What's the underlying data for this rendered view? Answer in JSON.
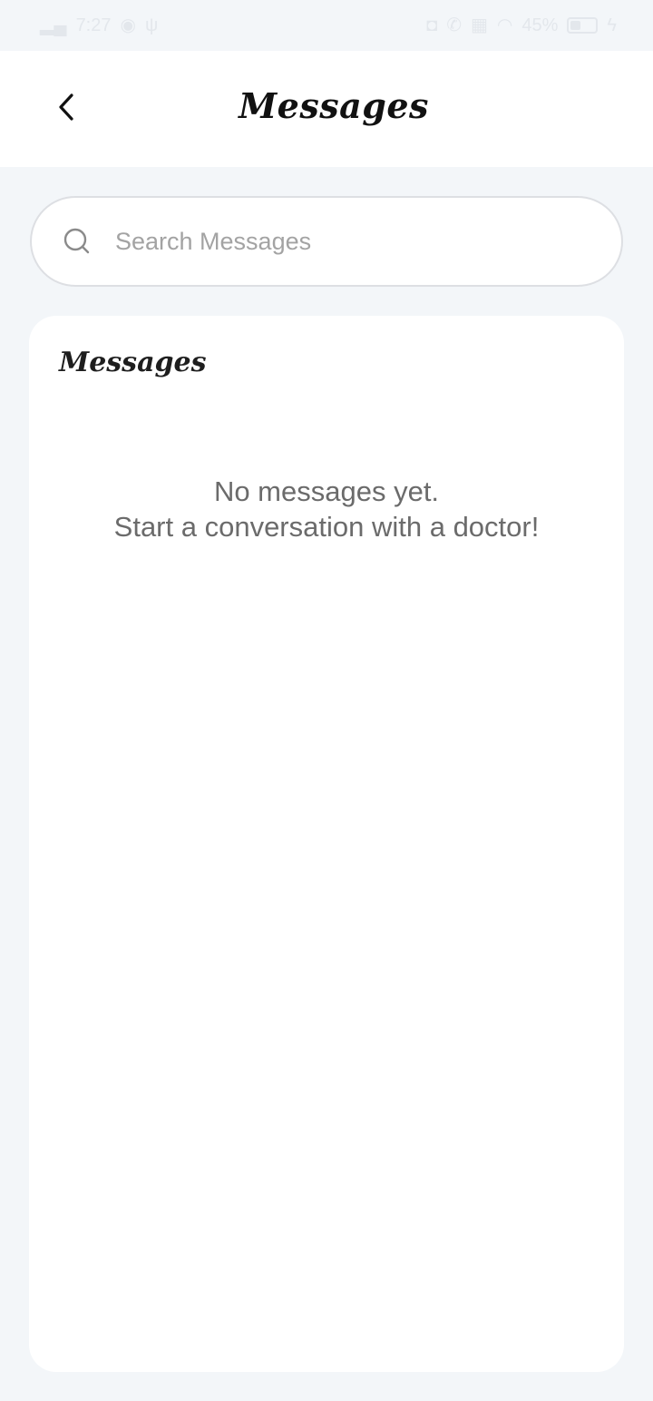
{
  "status_bar": {
    "time": "7:27",
    "battery": "45%",
    "icons": [
      "signal-icon",
      "game-icon",
      "usb-icon",
      "alarm-icon",
      "call-icon",
      "network-icon",
      "wifi-icon",
      "battery-icon",
      "charging-icon"
    ]
  },
  "header": {
    "title": "Messages",
    "back_icon": "chevron-left-icon"
  },
  "search": {
    "placeholder": "Search Messages",
    "value": "",
    "icon": "search-icon"
  },
  "messages_section": {
    "title": "Messages",
    "empty_line_1": "No messages yet.",
    "empty_line_2": "Start a conversation with a doctor!"
  },
  "colors": {
    "background": "#f3f6f9",
    "surface": "#ffffff",
    "title_text": "#111111",
    "muted_text": "#6b6b6b",
    "placeholder_text": "#a3a3a3",
    "border": "#dddfe3"
  }
}
